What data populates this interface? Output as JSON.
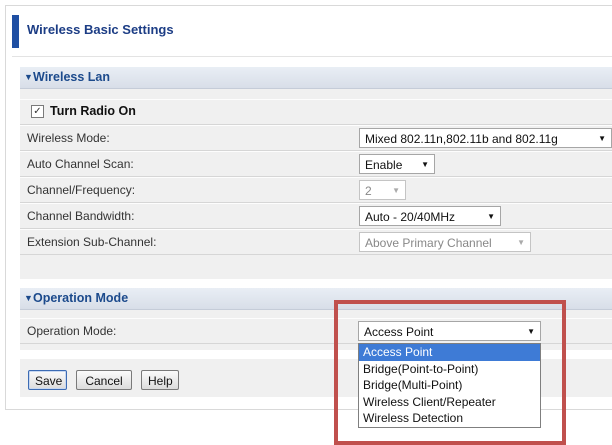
{
  "page": {
    "title": "Wireless Basic Settings"
  },
  "wireless_lan": {
    "section_title": "Wireless Lan",
    "turn_radio_on": {
      "label": "Turn Radio On",
      "checked": true,
      "check_glyph": "✓"
    },
    "wireless_mode": {
      "label": "Wireless Mode:",
      "value": "Mixed 802.11n,802.11b and 802.11g"
    },
    "auto_channel_scan": {
      "label": "Auto Channel Scan:",
      "value": "Enable"
    },
    "channel_frequency": {
      "label": "Channel/Frequency:",
      "value": "2",
      "disabled": true
    },
    "channel_bandwidth": {
      "label": "Channel Bandwidth:",
      "value": "Auto - 20/40MHz"
    },
    "extension_sub_channel": {
      "label": "Extension Sub-Channel:",
      "value": "Above Primary Channel",
      "disabled": true
    }
  },
  "operation_mode": {
    "section_title": "Operation Mode",
    "label": "Operation Mode:",
    "value": "Access Point",
    "options": [
      "Access Point",
      "Bridge(Point-to-Point)",
      "Bridge(Multi-Point)",
      "Wireless Client/Repeater",
      "Wireless Detection"
    ],
    "highlighted_index": 0
  },
  "buttons": {
    "save": "Save",
    "cancel": "Cancel",
    "help": "Help"
  },
  "icons": {
    "section_toggle": "triangle-down-icon",
    "dropdown_arrow": "caret-down-icon"
  },
  "colors": {
    "accent": "#1f4fa3",
    "section_text": "#1c4a8c",
    "highlight_box": "#c0504d",
    "selected_option": "#3e7bd6"
  }
}
